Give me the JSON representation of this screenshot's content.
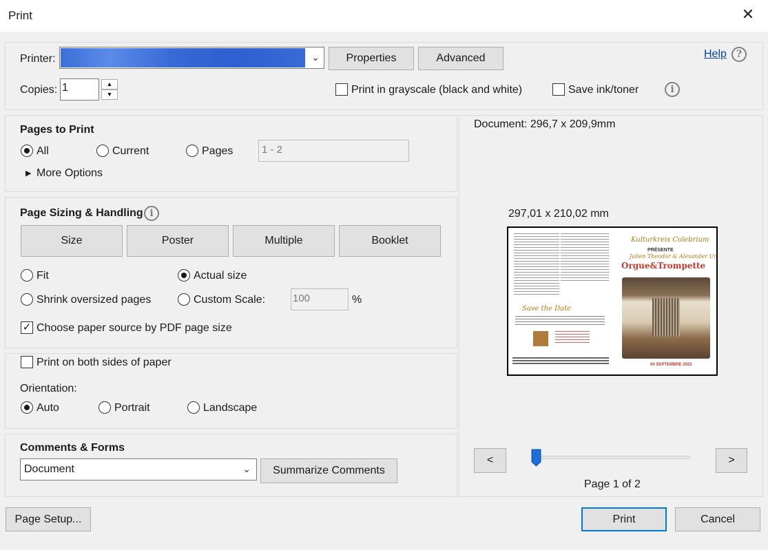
{
  "window": {
    "title": "Print",
    "close_glyph": "✕"
  },
  "printer": {
    "label": "Printer:",
    "selected": "",
    "properties": "Properties",
    "advanced": "Advanced",
    "help": "Help",
    "copies_label": "Copies:",
    "copies_value": "1",
    "grayscale_label": "Print in grayscale (black and white)",
    "grayscale_checked": false,
    "save_ink_label": "Save ink/toner",
    "save_ink_checked": false
  },
  "pages_to_print": {
    "heading": "Pages to Print",
    "options": [
      {
        "label": "All",
        "selected": true
      },
      {
        "label": "Current",
        "selected": false
      },
      {
        "label": "Pages",
        "selected": false
      }
    ],
    "range_value": "1 - 2",
    "more_options": "More Options"
  },
  "sizing": {
    "heading": "Page Sizing & Handling",
    "tabs": [
      "Size",
      "Poster",
      "Multiple",
      "Booklet"
    ],
    "active_tab": "Size",
    "fit": "Fit",
    "actual_size": "Actual size",
    "shrink": "Shrink oversized pages",
    "custom_scale": "Custom Scale:",
    "scale_value": "100",
    "scale_unit": "%",
    "selected_option": "Actual size",
    "paper_source_label": "Choose paper source by PDF page size",
    "paper_source_checked": true
  },
  "duplex": {
    "both_sides_label": "Print on both sides of paper",
    "both_sides_checked": false,
    "orientation_label": "Orientation:",
    "options": [
      {
        "label": "Auto",
        "selected": true
      },
      {
        "label": "Portrait",
        "selected": false
      },
      {
        "label": "Landscape",
        "selected": false
      }
    ]
  },
  "comments": {
    "heading": "Comments & Forms",
    "selected": "Document",
    "summarize": "Summarize Comments"
  },
  "preview": {
    "document_size": "Document: 296,7 x 209,9mm",
    "sheet_size": "297,01 x 210,02 mm",
    "prev": "<",
    "next": ">",
    "page_indicator": "Page 1 of 2",
    "current_page": 1,
    "total_pages": 2,
    "thumb": {
      "script_title": "Kulturkreis Colebrium",
      "presents": "PRÉSENTE",
      "performers": "Julien Theodor & Alexander Urhaus",
      "event": "Orgue&Trompette",
      "save_the_date": "Save the Date",
      "date": "04 SEPTEMBRE 2022"
    }
  },
  "footer": {
    "page_setup": "Page Setup...",
    "print": "Print",
    "cancel": "Cancel"
  }
}
